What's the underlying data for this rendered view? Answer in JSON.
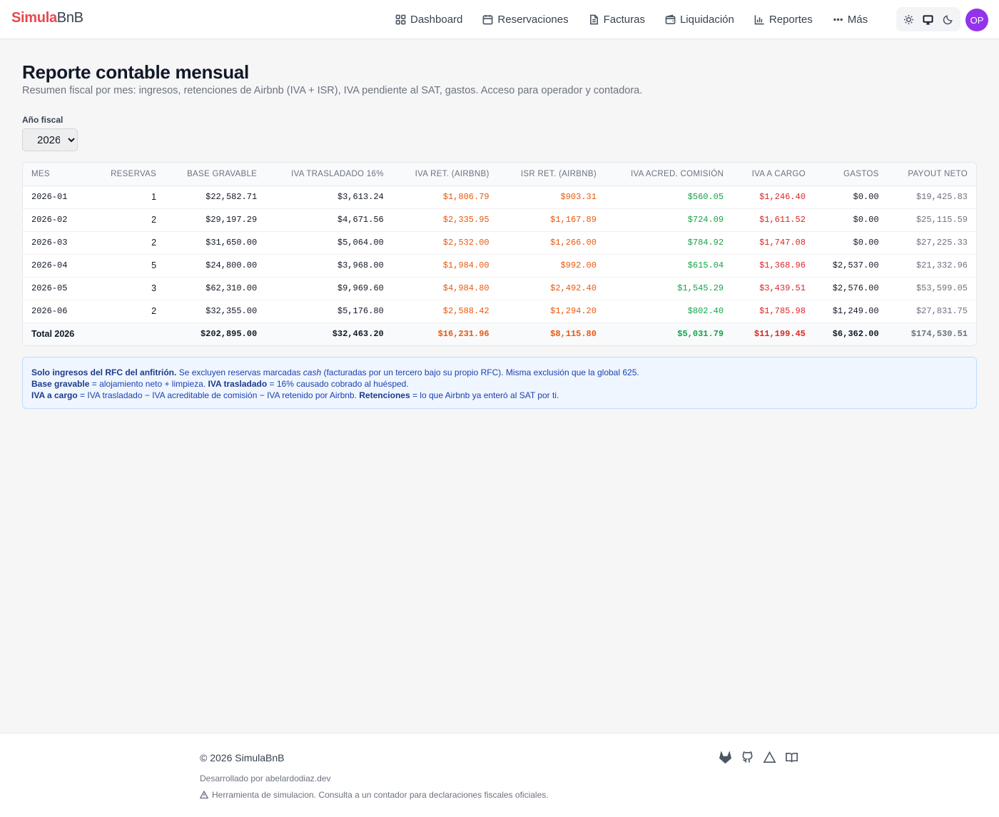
{
  "brand": {
    "part1": "Simula",
    "part2": "BnB"
  },
  "nav": {
    "items": [
      {
        "label": "Dashboard",
        "icon": "grid-icon"
      },
      {
        "label": "Reservaciones",
        "icon": "calendar-icon"
      },
      {
        "label": "Facturas",
        "icon": "document-icon"
      },
      {
        "label": "Liquidación",
        "icon": "wallet-icon"
      },
      {
        "label": "Reportes",
        "icon": "bar-chart-icon"
      },
      {
        "label": "Más",
        "icon": "more-icon"
      }
    ]
  },
  "user": {
    "initials": "OP"
  },
  "page": {
    "title": "Reporte contable mensual",
    "subtitle": "Resumen fiscal por mes: ingresos, retenciones de Airbnb (IVA + ISR), IVA pendiente al SAT, gastos. Acceso para operador y contadora."
  },
  "year_filter": {
    "label": "Año fiscal",
    "selected": "2026"
  },
  "table": {
    "headers": {
      "mes": "MES",
      "reservas": "RESERVAS",
      "base": "BASE GRAVABLE",
      "iva_tras": "IVA TRASLADADO 16%",
      "iva_ret": "IVA RET. (AIRBNB)",
      "isr_ret": "ISR RET. (AIRBNB)",
      "iva_acred": "IVA ACRED. COMISIÓN",
      "iva_cargo": "IVA A CARGO",
      "gastos": "GASTOS",
      "payout": "PAYOUT NETO"
    },
    "rows": [
      {
        "mes": "2026-01",
        "reservas": "1",
        "base": "$22,582.71",
        "iva_tras": "$3,613.24",
        "iva_ret": "$1,806.79",
        "isr_ret": "$903.31",
        "iva_acred": "$560.05",
        "iva_cargo": "$1,246.40",
        "gastos": "$0.00",
        "payout": "$19,425.83"
      },
      {
        "mes": "2026-02",
        "reservas": "2",
        "base": "$29,197.29",
        "iva_tras": "$4,671.56",
        "iva_ret": "$2,335.95",
        "isr_ret": "$1,167.89",
        "iva_acred": "$724.09",
        "iva_cargo": "$1,611.52",
        "gastos": "$0.00",
        "payout": "$25,115.59"
      },
      {
        "mes": "2026-03",
        "reservas": "2",
        "base": "$31,650.00",
        "iva_tras": "$5,064.00",
        "iva_ret": "$2,532.00",
        "isr_ret": "$1,266.00",
        "iva_acred": "$784.92",
        "iva_cargo": "$1,747.08",
        "gastos": "$0.00",
        "payout": "$27,225.33"
      },
      {
        "mes": "2026-04",
        "reservas": "5",
        "base": "$24,800.00",
        "iva_tras": "$3,968.00",
        "iva_ret": "$1,984.00",
        "isr_ret": "$992.00",
        "iva_acred": "$615.04",
        "iva_cargo": "$1,368.96",
        "gastos": "$2,537.00",
        "payout": "$21,332.96"
      },
      {
        "mes": "2026-05",
        "reservas": "3",
        "base": "$62,310.00",
        "iva_tras": "$9,969.60",
        "iva_ret": "$4,984.80",
        "isr_ret": "$2,492.40",
        "iva_acred": "$1,545.29",
        "iva_cargo": "$3,439.51",
        "gastos": "$2,576.00",
        "payout": "$53,599.05"
      },
      {
        "mes": "2026-06",
        "reservas": "2",
        "base": "$32,355.00",
        "iva_tras": "$5,176.80",
        "iva_ret": "$2,588.42",
        "isr_ret": "$1,294.20",
        "iva_acred": "$802.40",
        "iva_cargo": "$1,785.98",
        "gastos": "$1,249.00",
        "payout": "$27,831.75"
      }
    ],
    "total": {
      "label": "Total 2026",
      "base": "$202,895.00",
      "iva_tras": "$32,463.20",
      "iva_ret": "$16,231.96",
      "isr_ret": "$8,115.80",
      "iva_acred": "$5,031.79",
      "iva_cargo": "$11,199.45",
      "gastos": "$6,362.00",
      "payout": "$174,530.51"
    }
  },
  "note": {
    "l1_bold": "Solo ingresos del RFC del anfitrión.",
    "l1_a": " Se excluyen reservas marcadas ",
    "l1_em": "cash",
    "l1_b": " (facturadas por un tercero bajo su propio RFC). Misma exclusión que la global 625.",
    "l2_bold1": "Base gravable",
    "l2_a": " = alojamiento neto + limpieza. ",
    "l2_bold2": "IVA trasladado",
    "l2_b": " = 16% causado cobrado al huésped.",
    "l3_bold1": "IVA a cargo",
    "l3_a": " = IVA trasladado − IVA acreditable de comisión − IVA retenido por Airbnb. ",
    "l3_bold2": "Retenciones",
    "l3_b": " = lo que Airbnb ya enteró al SAT por ti."
  },
  "footer": {
    "copyright": "© 2026 SimulaBnB",
    "developer": "Desarrollado por abelardodiaz.dev",
    "disclaimer": "Herramienta de simulacion. Consulta a un contador para declaraciones fiscales oficiales."
  },
  "colors": {
    "brand": "#e8474c",
    "avatar": "#9333ea",
    "retention": "#ea580c",
    "credit": "#16a34a",
    "payable": "#dc2626",
    "note_bg": "#eff6ff"
  }
}
